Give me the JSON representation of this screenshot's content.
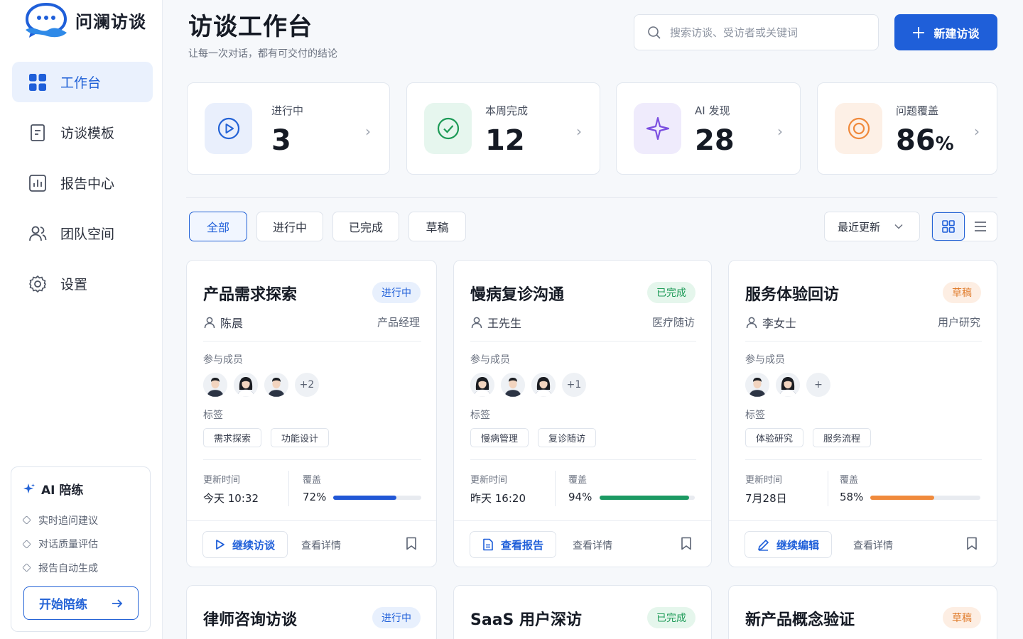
{
  "app": {
    "name": "问澜访谈"
  },
  "nav": [
    {
      "label": "工作台",
      "icon": "dashboard-icon",
      "active": true
    },
    {
      "label": "访谈模板",
      "icon": "template-icon",
      "active": false
    },
    {
      "label": "报告中心",
      "icon": "report-icon",
      "active": false
    },
    {
      "label": "团队空间",
      "icon": "team-icon",
      "active": false
    },
    {
      "label": "设置",
      "icon": "gear-icon",
      "active": false
    }
  ],
  "ai_coach": {
    "title": "AI 陪练",
    "features": [
      "实时追问建议",
      "对话质量评估",
      "报告自动生成"
    ],
    "cta": "开始陪练"
  },
  "header": {
    "title": "访谈工作台",
    "subtitle": "让每一次对话，都有可交付的结论",
    "search_placeholder": "搜索访谈、受访者或关键词",
    "new_button": "新建访谈"
  },
  "stats": [
    {
      "label": "进行中",
      "value": "3",
      "unit": "",
      "color": "#2463d6",
      "icon": "play-icon"
    },
    {
      "label": "本周完成",
      "value": "12",
      "unit": "",
      "color": "#1c9a56",
      "icon": "check-circle-icon"
    },
    {
      "label": "AI 发现",
      "value": "28",
      "unit": "",
      "color": "#7b4fe0",
      "icon": "sparkle-icon"
    },
    {
      "label": "问题覆盖",
      "value": "86",
      "unit": "%",
      "color": "#f08a3c",
      "icon": "target-icon"
    }
  ],
  "filters": {
    "tabs": [
      "全部",
      "进行中",
      "已完成",
      "草稿"
    ],
    "active": "全部",
    "sort": "最近更新"
  },
  "cards": [
    {
      "title": "产品需求探索",
      "status": "进行中",
      "status_type": "run",
      "person": "陈晨",
      "role": "产品经理",
      "members_label": "参与成员",
      "members_more": "+2",
      "tags_label": "标签",
      "tags": [
        "需求探索",
        "功能设计"
      ],
      "updated_label": "更新时间",
      "updated": "今天  10:32",
      "coverage_label": "覆盖",
      "coverage": "72%",
      "coverage_value": 0.72,
      "coverage_color": "#2157d6",
      "action": "继续访谈",
      "action_icon": "play-outline-icon",
      "detail": "查看详情"
    },
    {
      "title": "慢病复诊沟通",
      "status": "已完成",
      "status_type": "done",
      "person": "王先生",
      "role": "医疗随访",
      "members_label": "参与成员",
      "members_more": "+1",
      "tags_label": "标签",
      "tags": [
        "慢病管理",
        "复诊随访"
      ],
      "updated_label": "更新时间",
      "updated": "昨天  16:20",
      "coverage_label": "覆盖",
      "coverage": "94%",
      "coverage_value": 0.94,
      "coverage_color": "#1c9a63",
      "action": "查看报告",
      "action_icon": "document-icon",
      "detail": "查看详情"
    },
    {
      "title": "服务体验回访",
      "status": "草稿",
      "status_type": "draft",
      "person": "李女士",
      "role": "用户研究",
      "members_label": "参与成员",
      "members_more": "+",
      "tags_label": "标签",
      "tags": [
        "体验研究",
        "服务流程"
      ],
      "updated_label": "更新时间",
      "updated": "7月28日",
      "coverage_label": "覆盖",
      "coverage": "58%",
      "coverage_value": 0.58,
      "coverage_color": "#f08a3c",
      "action": "继续编辑",
      "action_icon": "pencil-icon",
      "detail": "查看详情"
    }
  ],
  "cards_row2": [
    {
      "title": "律师咨询访谈",
      "status": "进行中",
      "status_type": "run"
    },
    {
      "title": "SaaS 用户深访",
      "status": "已完成",
      "status_type": "done"
    },
    {
      "title": "新产品概念验证",
      "status": "草稿",
      "status_type": "draft"
    }
  ]
}
